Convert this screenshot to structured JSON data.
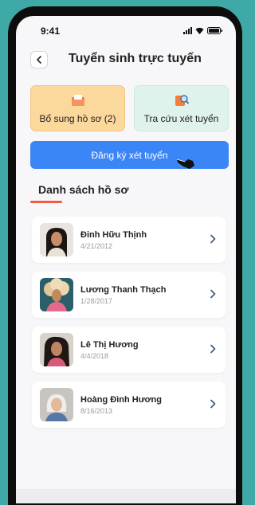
{
  "status_bar": {
    "time": "9:41"
  },
  "header": {
    "title": "Tuyển sinh trực tuyến"
  },
  "actions": {
    "supplement_label": "Bổ sung hồ sơ (2)",
    "lookup_label": "Tra cứu xét tuyển",
    "register_label": "Đăng ký xét tuyển"
  },
  "section": {
    "title": "Danh sách hồ sơ"
  },
  "records": [
    {
      "name": "Đinh Hữu Thịnh",
      "date": "4/21/2012"
    },
    {
      "name": "Lương Thanh Thạch",
      "date": "1/28/2017"
    },
    {
      "name": "Lê Thị Hương",
      "date": "4/4/2018"
    },
    {
      "name": "Hoàng Đình Hương",
      "date": "8/16/2013"
    }
  ],
  "colors": {
    "background": "#3ea9a6",
    "supplement_card": "#fbd89c",
    "lookup_card": "#dff2ec",
    "primary": "#3b86f6",
    "accent": "#f25a3b"
  },
  "icons": {
    "back": "chevron-left-icon",
    "supplement": "folder-icon",
    "lookup": "search-document-icon",
    "row": "chevron-right-icon"
  }
}
